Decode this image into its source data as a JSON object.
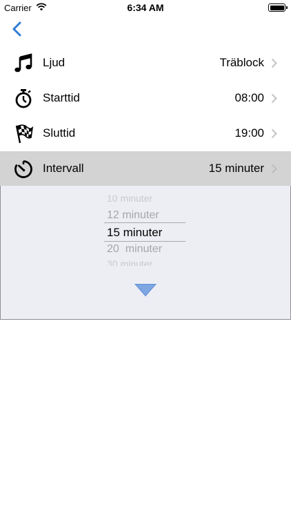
{
  "status_bar": {
    "carrier": "Carrier",
    "time": "6:34 AM"
  },
  "nav": {
    "back_icon": "chevron-left-icon",
    "accent_color": "#2f7bd8"
  },
  "settings": [
    {
      "icon": "music-note-icon",
      "label": "Ljud",
      "value": "Träblock"
    },
    {
      "icon": "stopwatch-icon",
      "label": "Starttid",
      "value": "08:00"
    },
    {
      "icon": "checkered-flag-icon",
      "label": "Sluttid",
      "value": "19:00"
    },
    {
      "icon": "timer-icon",
      "label": "Intervall",
      "value": "15 minuter",
      "selected": true
    }
  ],
  "picker": {
    "items": [
      "10 minuter",
      "12 minuter",
      "15 minuter",
      "20  minuter",
      "30 minuter"
    ],
    "selected": "15 minuter"
  },
  "collapse": {
    "icon": "triangle-down-icon",
    "color": "#7da6e3"
  }
}
